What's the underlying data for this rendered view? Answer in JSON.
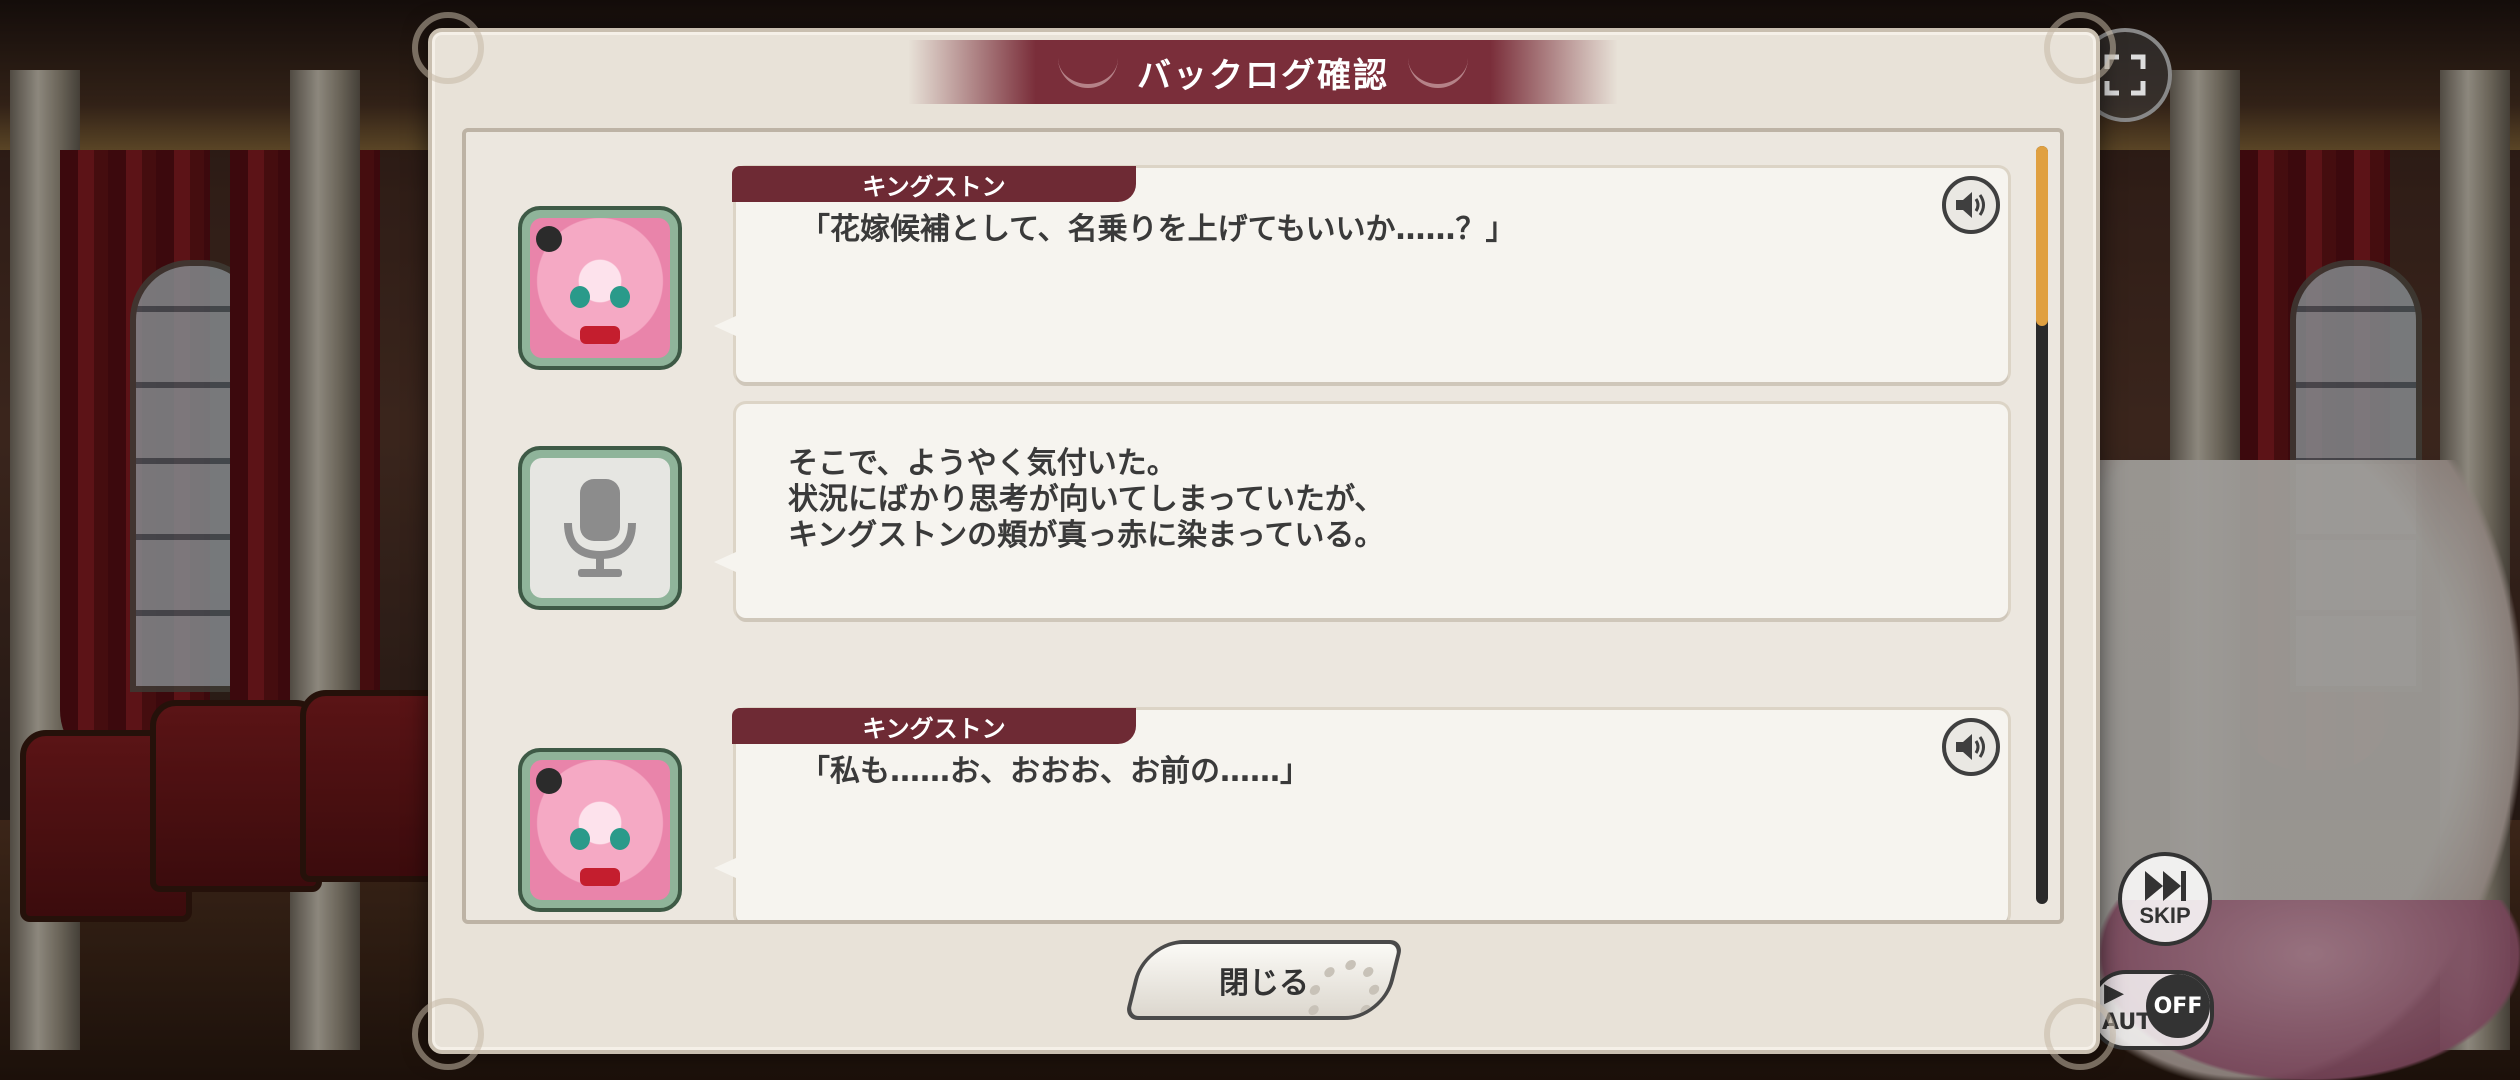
{
  "dialog": {
    "title": "バックログ確認",
    "close_label": "閉じる"
  },
  "backlog": {
    "entries": [
      {
        "type": "dialogue",
        "speaker": "キングストン",
        "text": "「花嫁候補として、名乗りを上げてもいいか……？」",
        "has_voice": true
      },
      {
        "type": "narration",
        "lines": [
          "そこで、ようやく気付いた。",
          "状況にばかり思考が向いてしまっていたが、",
          "キングストンの頬が真っ赤に染まっている。"
        ],
        "has_voice": false
      },
      {
        "type": "dialogue",
        "speaker": "キングストン",
        "text": "「私も……お、おおお、お前の……」",
        "has_voice": true
      }
    ],
    "scroll_position": 0
  },
  "controls": {
    "skip_label": "SKIP",
    "auto_label": "AUTO",
    "auto_state": "OFF"
  },
  "icons": {
    "voice": "speaker-icon",
    "narration": "microphone-icon",
    "fullscreen": "fullscreen-icon",
    "skip": "fast-forward-icon",
    "auto": "play-icon"
  },
  "colors": {
    "title_bar": "#7a2e3a",
    "name_tag": "#6e2a34",
    "avatar_frame": "#8fb49a",
    "scroll_thumb": "#e0a040"
  }
}
